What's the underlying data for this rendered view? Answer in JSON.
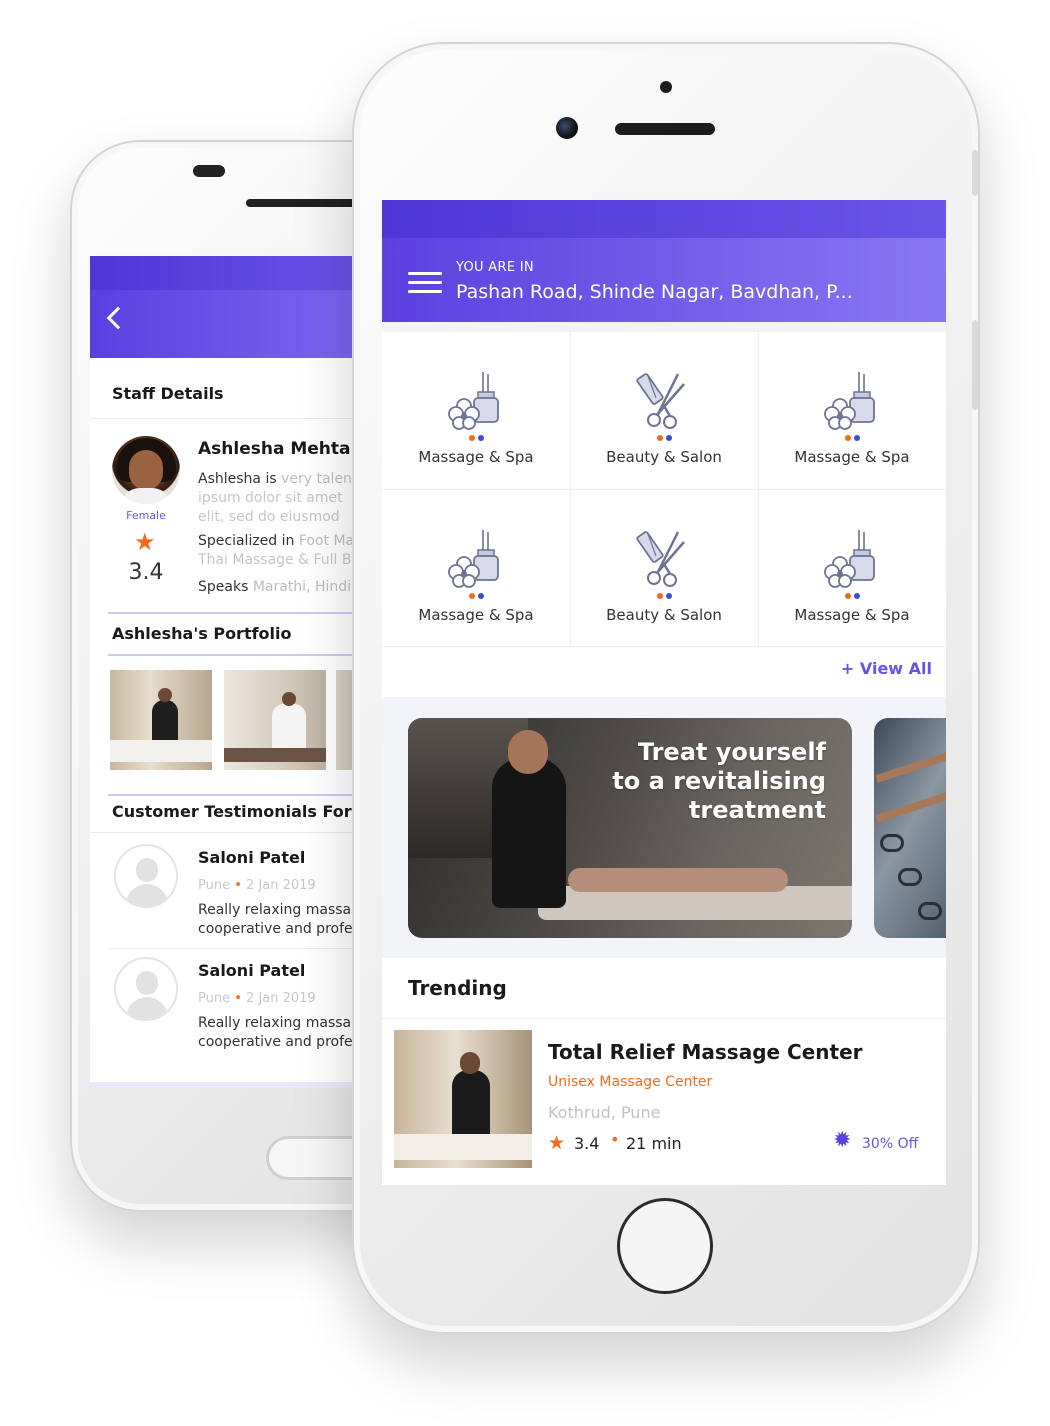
{
  "staff_screen": {
    "section_staff_details": "Staff Details",
    "staff": {
      "name": "Ashlesha Mehta",
      "gender": "Female",
      "rating": "3.4",
      "bio_lead": "Ashlesha is",
      "bio_rest": " very talented",
      "bio_line2": "ipsum dolor sit amet",
      "bio_line3": "elit, sed do eiusmod",
      "specialized_label": "Specialized in",
      "specialized_value": " Foot Massage",
      "specialized_line2": "Thai Massage & Full Body",
      "speaks_label": "Speaks",
      "speaks_value": " Marathi, Hindi"
    },
    "section_portfolio": "Ashlesha's Portfolio",
    "section_testimonials": "Customer Testimonials For",
    "testimonials": [
      {
        "name": "Saloni Patel",
        "city": "Pune",
        "date": "2 Jan 2019",
        "line1": "Really relaxing massage",
        "line2": "cooperative and professional"
      },
      {
        "name": "Saloni Patel",
        "city": "Pune",
        "date": "2 Jan 2019",
        "line1": "Really relaxing massage",
        "line2": "cooperative and professional"
      }
    ]
  },
  "home_screen": {
    "location_label": "YOU ARE IN",
    "location": "Pashan Road, Shinde Nagar, Bavdhan, P...",
    "categories": [
      {
        "label": "Massage & Spa",
        "icon": "spa-icon"
      },
      {
        "label": "Beauty & Salon",
        "icon": "salon-icon"
      },
      {
        "label": "Massage & Spa",
        "icon": "spa-icon"
      },
      {
        "label": "Massage & Spa",
        "icon": "spa-icon"
      },
      {
        "label": "Beauty & Salon",
        "icon": "salon-icon"
      },
      {
        "label": "Massage & Spa",
        "icon": "spa-icon"
      }
    ],
    "view_all": "+ View All",
    "banner": {
      "line1": "Treat yourself",
      "line2": "to a revitalising",
      "line3": "treatment"
    },
    "trending_title": "Trending",
    "trending": {
      "name": "Total Relief Massage Center",
      "type": "Unisex Massage Center",
      "location": "Kothrud, Pune",
      "rating": "3.4",
      "separator": "•",
      "time": "21 min",
      "offer": "30% Off"
    }
  },
  "colors": {
    "primary": "#5b40e0",
    "accent_orange": "#f26b1d",
    "accent_blue": "#3b4bd8"
  }
}
